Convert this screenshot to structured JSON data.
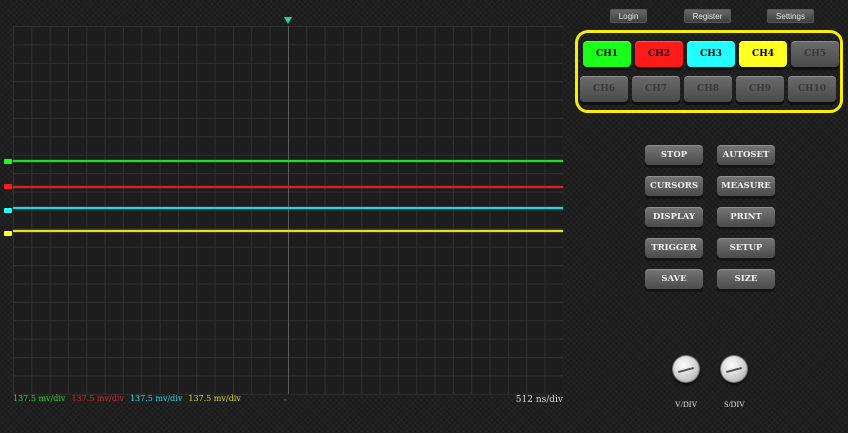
{
  "header": {
    "login_label": "Login",
    "register_label": "Register",
    "settings_label": "Settings"
  },
  "channels": [
    {
      "label": "CH1",
      "active": true,
      "color": "#1aff1a"
    },
    {
      "label": "CH2",
      "active": true,
      "color": "#ff1a1a"
    },
    {
      "label": "CH3",
      "active": true,
      "color": "#22ffff"
    },
    {
      "label": "CH4",
      "active": true,
      "color": "#ffff22"
    },
    {
      "label": "CH5",
      "active": false
    },
    {
      "label": "CH6",
      "active": false
    },
    {
      "label": "CH7",
      "active": false
    },
    {
      "label": "CH8",
      "active": false
    },
    {
      "label": "CH9",
      "active": false
    },
    {
      "label": "CH10",
      "active": false
    }
  ],
  "controls": {
    "stop": "STOP",
    "autoset": "AUTOSET",
    "cursors": "CURSORS",
    "measure": "MEASURE",
    "display": "DISPLAY",
    "print": "PRINT",
    "trigger": "TRIGGER",
    "setup": "SETUP",
    "save": "SAVE",
    "size": "SIZE"
  },
  "knobs": {
    "vdiv_label": "V/DIV",
    "sdiv_label": "S/DIV"
  },
  "scope": {
    "vdivs": [
      {
        "text": "137.5 mv/div",
        "color": "#22dd22"
      },
      {
        "text": "137.5 mv/div",
        "color": "#dd2222"
      },
      {
        "text": "137.5 mv/div",
        "color": "#22dddd"
      },
      {
        "text": "137.5 mv/div",
        "color": "#dddd22"
      }
    ],
    "time_div": "512 ns/div",
    "trace_colors": [
      "#22dd22",
      "#e02020",
      "#22d8d8",
      "#e0e020"
    ]
  },
  "colors": {
    "accent_border": "#f6f000",
    "trigger_marker": "#1fd4a0"
  }
}
